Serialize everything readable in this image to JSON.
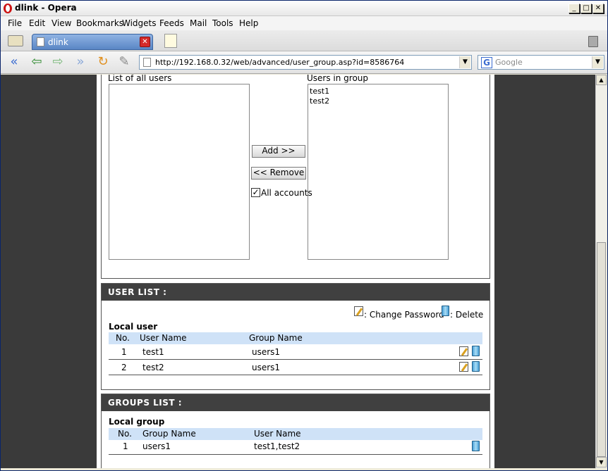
{
  "window": {
    "title": "dlink - Opera",
    "buttons": {
      "minimize": "_",
      "maximize": "□",
      "close": "✕"
    }
  },
  "menu": [
    "File",
    "Edit",
    "View",
    "Bookmarks",
    "Widgets",
    "Feeds",
    "Mail",
    "Tools",
    "Help"
  ],
  "tab": {
    "label": "dlink"
  },
  "address": {
    "url": "http://192.168.0.32/web/advanced/user_group.asp?id=8586764"
  },
  "search": {
    "placeholder": "Google"
  },
  "group_members": {
    "all_users_label": "List of all users",
    "all_users": [],
    "group_users_label": "Users in group",
    "group_users": [
      "test1",
      "test2"
    ],
    "add_button": "Add >>",
    "remove_button": "<< Remove",
    "all_accounts_label": "All accounts",
    "all_accounts_checked": true
  },
  "user_list": {
    "header": "USER LIST :",
    "change_password_label": ": Change Password",
    "delete_label": ": Delete",
    "section_title": "Local user",
    "columns": [
      "No.",
      "User Name",
      "Group Name"
    ],
    "rows": [
      {
        "no": "1",
        "user": "test1",
        "group": "users1"
      },
      {
        "no": "2",
        "user": "test2",
        "group": "users1"
      }
    ]
  },
  "groups_list": {
    "header": "GROUPS LIST :",
    "section_title": "Local group",
    "columns": [
      "No.",
      "Group Name",
      "User Name"
    ],
    "rows": [
      {
        "no": "1",
        "group": "users1",
        "users": "test1,test2"
      }
    ]
  },
  "icons": {
    "opera": "opera-logo-icon",
    "edit": "edit-icon",
    "delete": "trash-icon"
  },
  "colors": {
    "panel_header": "#404040",
    "table_header": "#cfe2f7",
    "side_background": "#3a3a3a"
  }
}
